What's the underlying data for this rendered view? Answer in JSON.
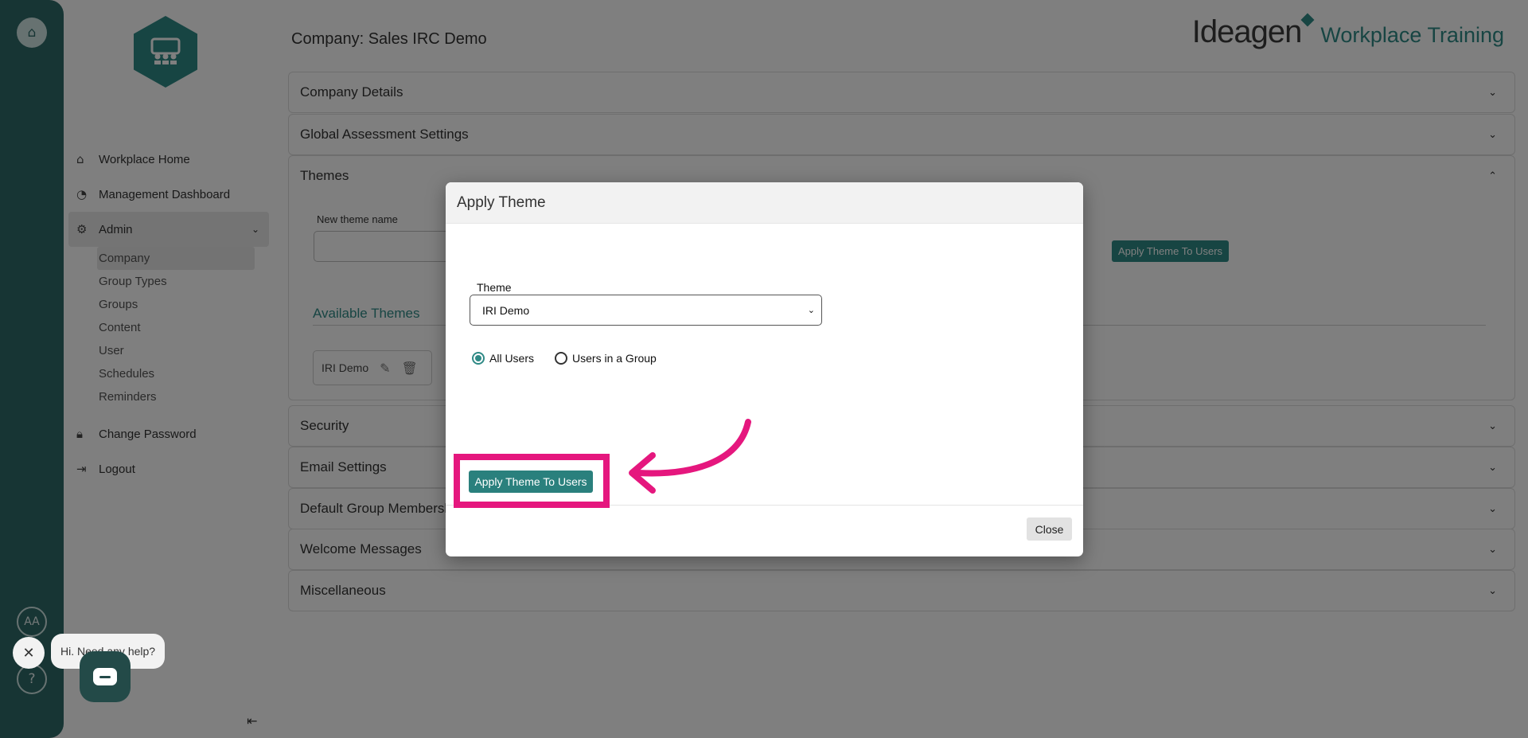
{
  "rail": {
    "avatar_initials": "AA",
    "help_glyph": "?"
  },
  "sidebar": {
    "nav": [
      {
        "label": "Workplace Home"
      },
      {
        "label": "Management Dashboard"
      },
      {
        "label": "Admin"
      }
    ],
    "admin_items": [
      "Company",
      "Group Types",
      "Groups",
      "Content",
      "User",
      "Schedules",
      "Reminders"
    ],
    "bottom_nav": [
      {
        "label": "Change Password"
      },
      {
        "label": "Logout"
      }
    ]
  },
  "header": {
    "company_label": "Company:  Sales IRC Demo",
    "brand_name": "Ideagen",
    "brand_product": "Workplace Training"
  },
  "panels": [
    "Company Details",
    "Global Assessment Settings",
    "Themes",
    "Security",
    "Email Settings",
    "Default Group Membership",
    "Welcome Messages",
    "Miscellaneous"
  ],
  "themes_panel": {
    "new_theme_label": "New theme name",
    "apply_theme_button": "Apply Theme To Users",
    "available_label": "Available Themes",
    "theme_chip": "IRI Demo"
  },
  "modal": {
    "title": "Apply Theme",
    "theme_label": "Theme",
    "theme_value": "IRI Demo",
    "radio_all": "All Users",
    "radio_group": "Users in a Group",
    "apply_button": "Apply Theme To Users",
    "close_button": "Close"
  },
  "chat": {
    "bubble_text": "Hi. Need any help?"
  },
  "colors": {
    "accent": "#2f8a86",
    "rail": "#2f6b69",
    "highlight": "#e5177e"
  }
}
